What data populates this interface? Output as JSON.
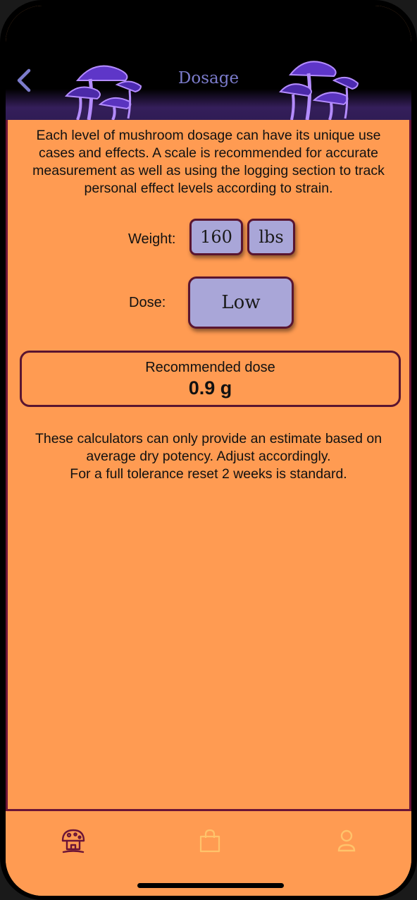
{
  "header": {
    "title": "Dosage",
    "back_icon": "chevron-left-icon"
  },
  "intro_text": "Each level of mushroom dosage can have its unique use cases and effects. A scale is recommended for accurate measurement as well as using the logging section to track personal effect levels according to strain.",
  "weight": {
    "label": "Weight:",
    "value": "160",
    "unit": "lbs"
  },
  "dose": {
    "label": "Dose:",
    "value": "Low"
  },
  "result": {
    "label": "Recommended dose",
    "value": "0.9 g"
  },
  "note": {
    "line1": "These calculators can only provide an estimate based on average dry potency. Adjust accordingly.",
    "line2": "For a full tolerance reset 2 weeks is standard."
  },
  "tabbar": {
    "tabs": [
      {
        "icon": "mushroom-home-icon",
        "active": true
      },
      {
        "icon": "shopping-bag-icon",
        "active": false
      },
      {
        "icon": "profile-icon",
        "active": false
      }
    ]
  },
  "colors": {
    "background": "#ff9b52",
    "accent": "#6b1437",
    "pill": "#a9a6d8",
    "title": "#7c7ccc",
    "inactive_tab": "#ffc36b"
  }
}
